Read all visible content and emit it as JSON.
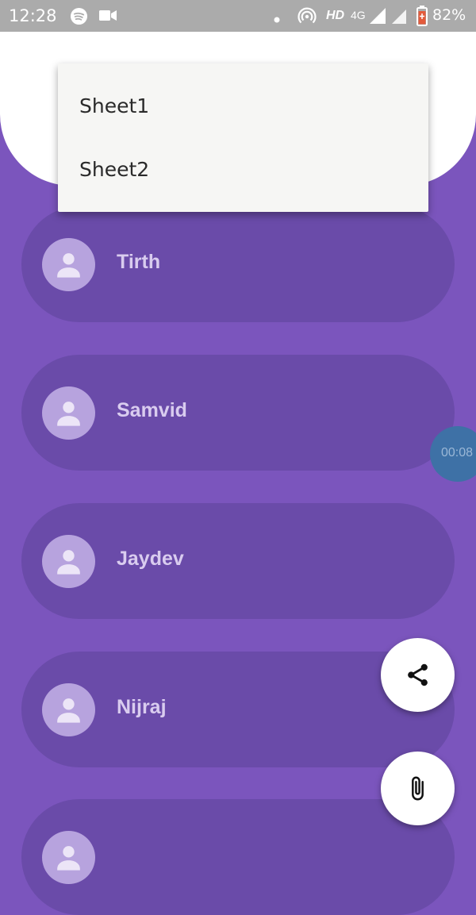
{
  "status_bar": {
    "time": "12:28",
    "network_hd": "HD",
    "network_type": "4G",
    "battery": "82%"
  },
  "header": {
    "title": ""
  },
  "menu": {
    "items": [
      {
        "label": "Sheet1"
      },
      {
        "label": "Sheet2"
      }
    ]
  },
  "contacts": [
    {
      "name": "Tirth"
    },
    {
      "name": "Samvid"
    },
    {
      "name": "Jaydev"
    },
    {
      "name": "Nijraj"
    },
    {
      "name": ""
    }
  ],
  "timer": {
    "text": "00:08"
  },
  "fabs": {
    "share_icon": "share-icon",
    "attach_icon": "paperclip-icon"
  },
  "colors": {
    "background": "#7b55bd",
    "card": "#6a4ba9",
    "avatar": "#b7a3de",
    "status_bar": "#ababab",
    "timer_bubble": "#3e71a6"
  }
}
